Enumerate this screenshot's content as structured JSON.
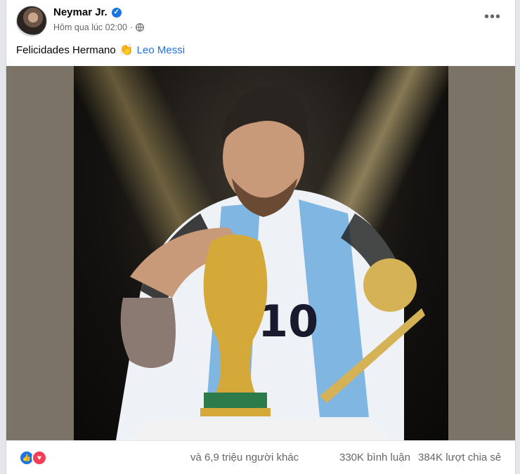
{
  "post": {
    "author_name": "Neymar Jr.",
    "verified_icon": "verified-badge-icon",
    "timestamp": "Hôm qua lúc 02:00",
    "separator": "·",
    "privacy_icon": "globe-icon",
    "more_label": "•••",
    "caption_text": "Felicidades Hermano",
    "caption_emoji": "👏",
    "mention": "Leo Messi"
  },
  "media": {
    "description_icon": "photo-messi-world-cup-trophy"
  },
  "footer": {
    "reaction_icons": [
      "like-reaction-icon",
      "love-reaction-icon"
    ],
    "others_text": "và 6,9 triệu người khác",
    "comments_text": "330K bình luận",
    "shares_text": "384K lượt chia sẻ"
  },
  "colors": {
    "link": "#216fdb",
    "secondary_text": "#65676b",
    "like_blue": "#1b74e4",
    "love_red": "#f33e58"
  }
}
